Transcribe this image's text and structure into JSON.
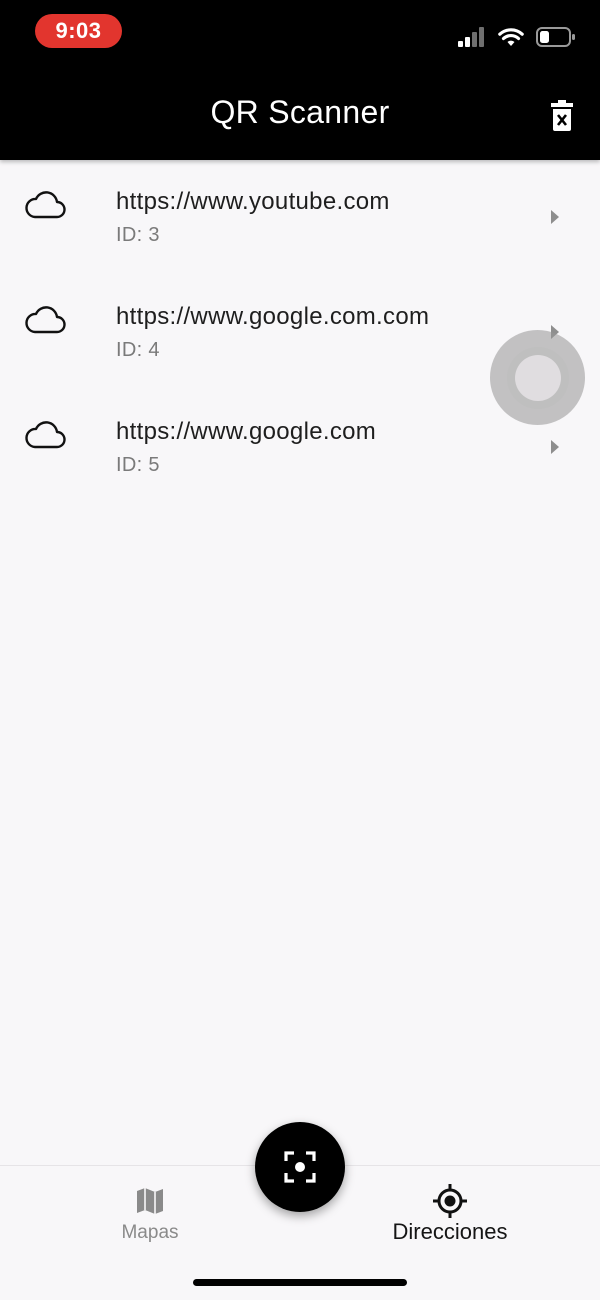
{
  "status_bar": {
    "time": "9:03",
    "time_badge_color": "#e2352e"
  },
  "app_bar": {
    "title": "QR Scanner",
    "action_icon": "delete-forever-icon",
    "background": "#000000"
  },
  "scans": [
    {
      "icon": "cloud-icon",
      "url": "https://www.youtube.com",
      "id_text": "ID: 3"
    },
    {
      "icon": "cloud-icon",
      "url": "https://www.google.com.com",
      "id_text": "ID: 4"
    },
    {
      "icon": "cloud-icon",
      "url": "https://www.google.com",
      "id_text": "ID: 5"
    }
  ],
  "fab": {
    "icon": "qr-scan-frame-icon"
  },
  "bottom_nav": {
    "items": [
      {
        "label": "Mapas",
        "icon": "map-icon",
        "selected": false
      },
      {
        "label": "Direcciones",
        "icon": "gps-target-icon",
        "selected": true
      }
    ]
  }
}
